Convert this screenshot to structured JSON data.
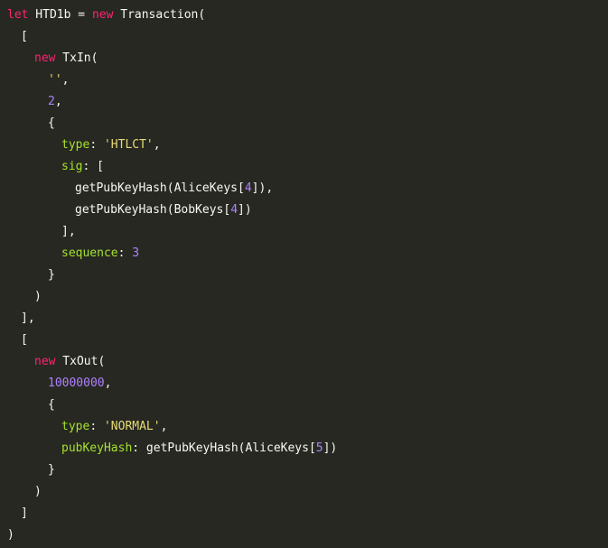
{
  "code": {
    "declaration": {
      "keyword": "let",
      "var_name": " HTD1b = ",
      "new_kw": "new",
      "constructor": " Transaction("
    },
    "open_inputs": "[",
    "txin": {
      "new_kw": "new",
      "constructor": " TxIn(",
      "empty_str": "''",
      "comma": ",",
      "index": "2",
      "open_brace": "{",
      "type_key": "type",
      "colon": ": ",
      "type_value": "'HTLCT'",
      "sig_key": "sig",
      "sig_open": ": [",
      "sig_line1_pre": "getPubKeyHash(AliceKeys[",
      "sig_line1_num": "4",
      "sig_line1_post": "]),",
      "sig_line2_pre": "getPubKeyHash(BobKeys[",
      "sig_line2_num": "4",
      "sig_line2_post": "])",
      "sig_close": "],",
      "sequence_key": "sequence",
      "sequence_value": "3",
      "close_brace": "}",
      "close_paren": ")"
    },
    "close_inputs": "],",
    "open_outputs": "[",
    "txout": {
      "new_kw": "new",
      "constructor": " TxOut(",
      "amount": "10000000",
      "comma": ",",
      "open_brace": "{",
      "type_key": "type",
      "colon": ": ",
      "type_value": "'NORMAL'",
      "pkh_key": "pubKeyHash",
      "pkh_pre": ": getPubKeyHash(AliceKeys[",
      "pkh_num": "5",
      "pkh_post": "])",
      "close_brace": "}",
      "close_paren": ")"
    },
    "close_outputs": "]",
    "close_transaction": ")"
  },
  "colors": {
    "background": "#272822",
    "keyword": "#f92672",
    "string": "#e6db74",
    "number": "#ae81ff",
    "property": "#a6e22e",
    "text": "#f8f8f2"
  }
}
